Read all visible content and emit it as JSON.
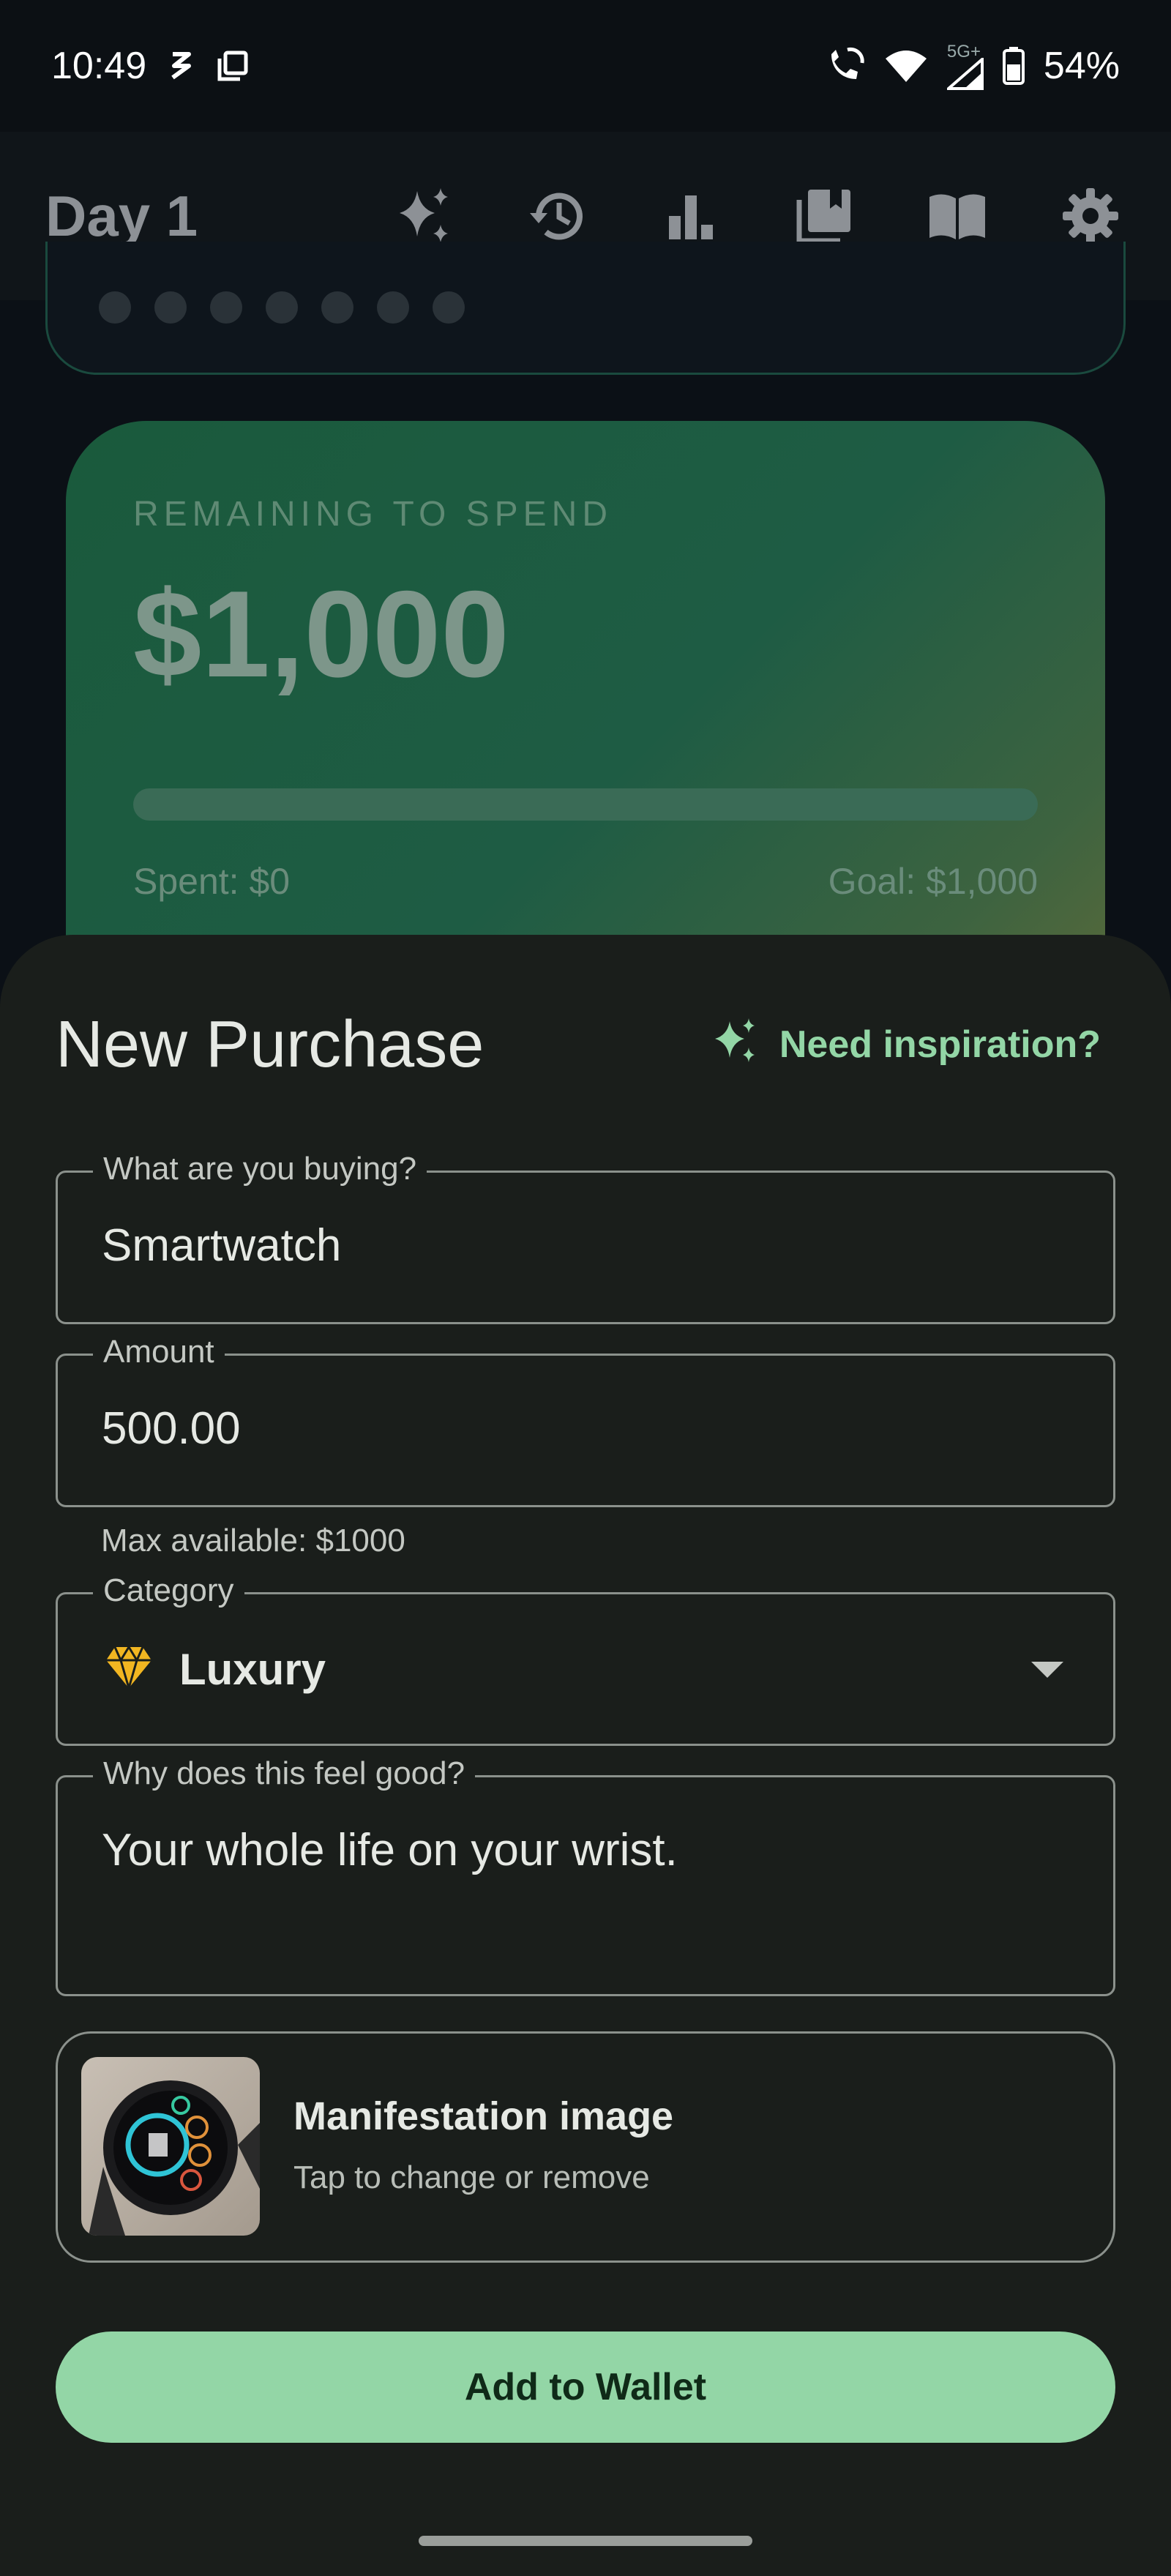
{
  "status_bar": {
    "time": "10:49",
    "battery": "54%",
    "network": "5G+"
  },
  "app_bar": {
    "title": "Day 1",
    "actions": [
      "sparkles-icon",
      "history-icon",
      "bar-chart-icon",
      "library-icon",
      "book-icon",
      "settings-icon"
    ]
  },
  "budget_card": {
    "label": "REMAINING TO SPEND",
    "amount": "$1,000",
    "spent": "Spent: $0",
    "goal": "Goal: $1,000",
    "progress_fraction": 0
  },
  "sheet": {
    "title": "New Purchase",
    "inspiration": "Need inspiration?",
    "item_field": {
      "label": "What are you buying?",
      "value": "Smartwatch"
    },
    "amount_field": {
      "label": "Amount",
      "value": "500.00",
      "helper": "Max available: $1000"
    },
    "category_field": {
      "label": "Category",
      "value": "Luxury",
      "icon": "diamond-icon"
    },
    "reason_field": {
      "label": "Why does this feel good?",
      "value": "Your whole life on your wrist."
    },
    "image_card": {
      "title": "Manifestation image",
      "subtitle": "Tap to change or remove"
    },
    "submit": "Add to Wallet"
  },
  "colors": {
    "accent": "#93d6a6",
    "sheet_bg": "#1a1e1b",
    "category_icon": "#f2b621"
  }
}
